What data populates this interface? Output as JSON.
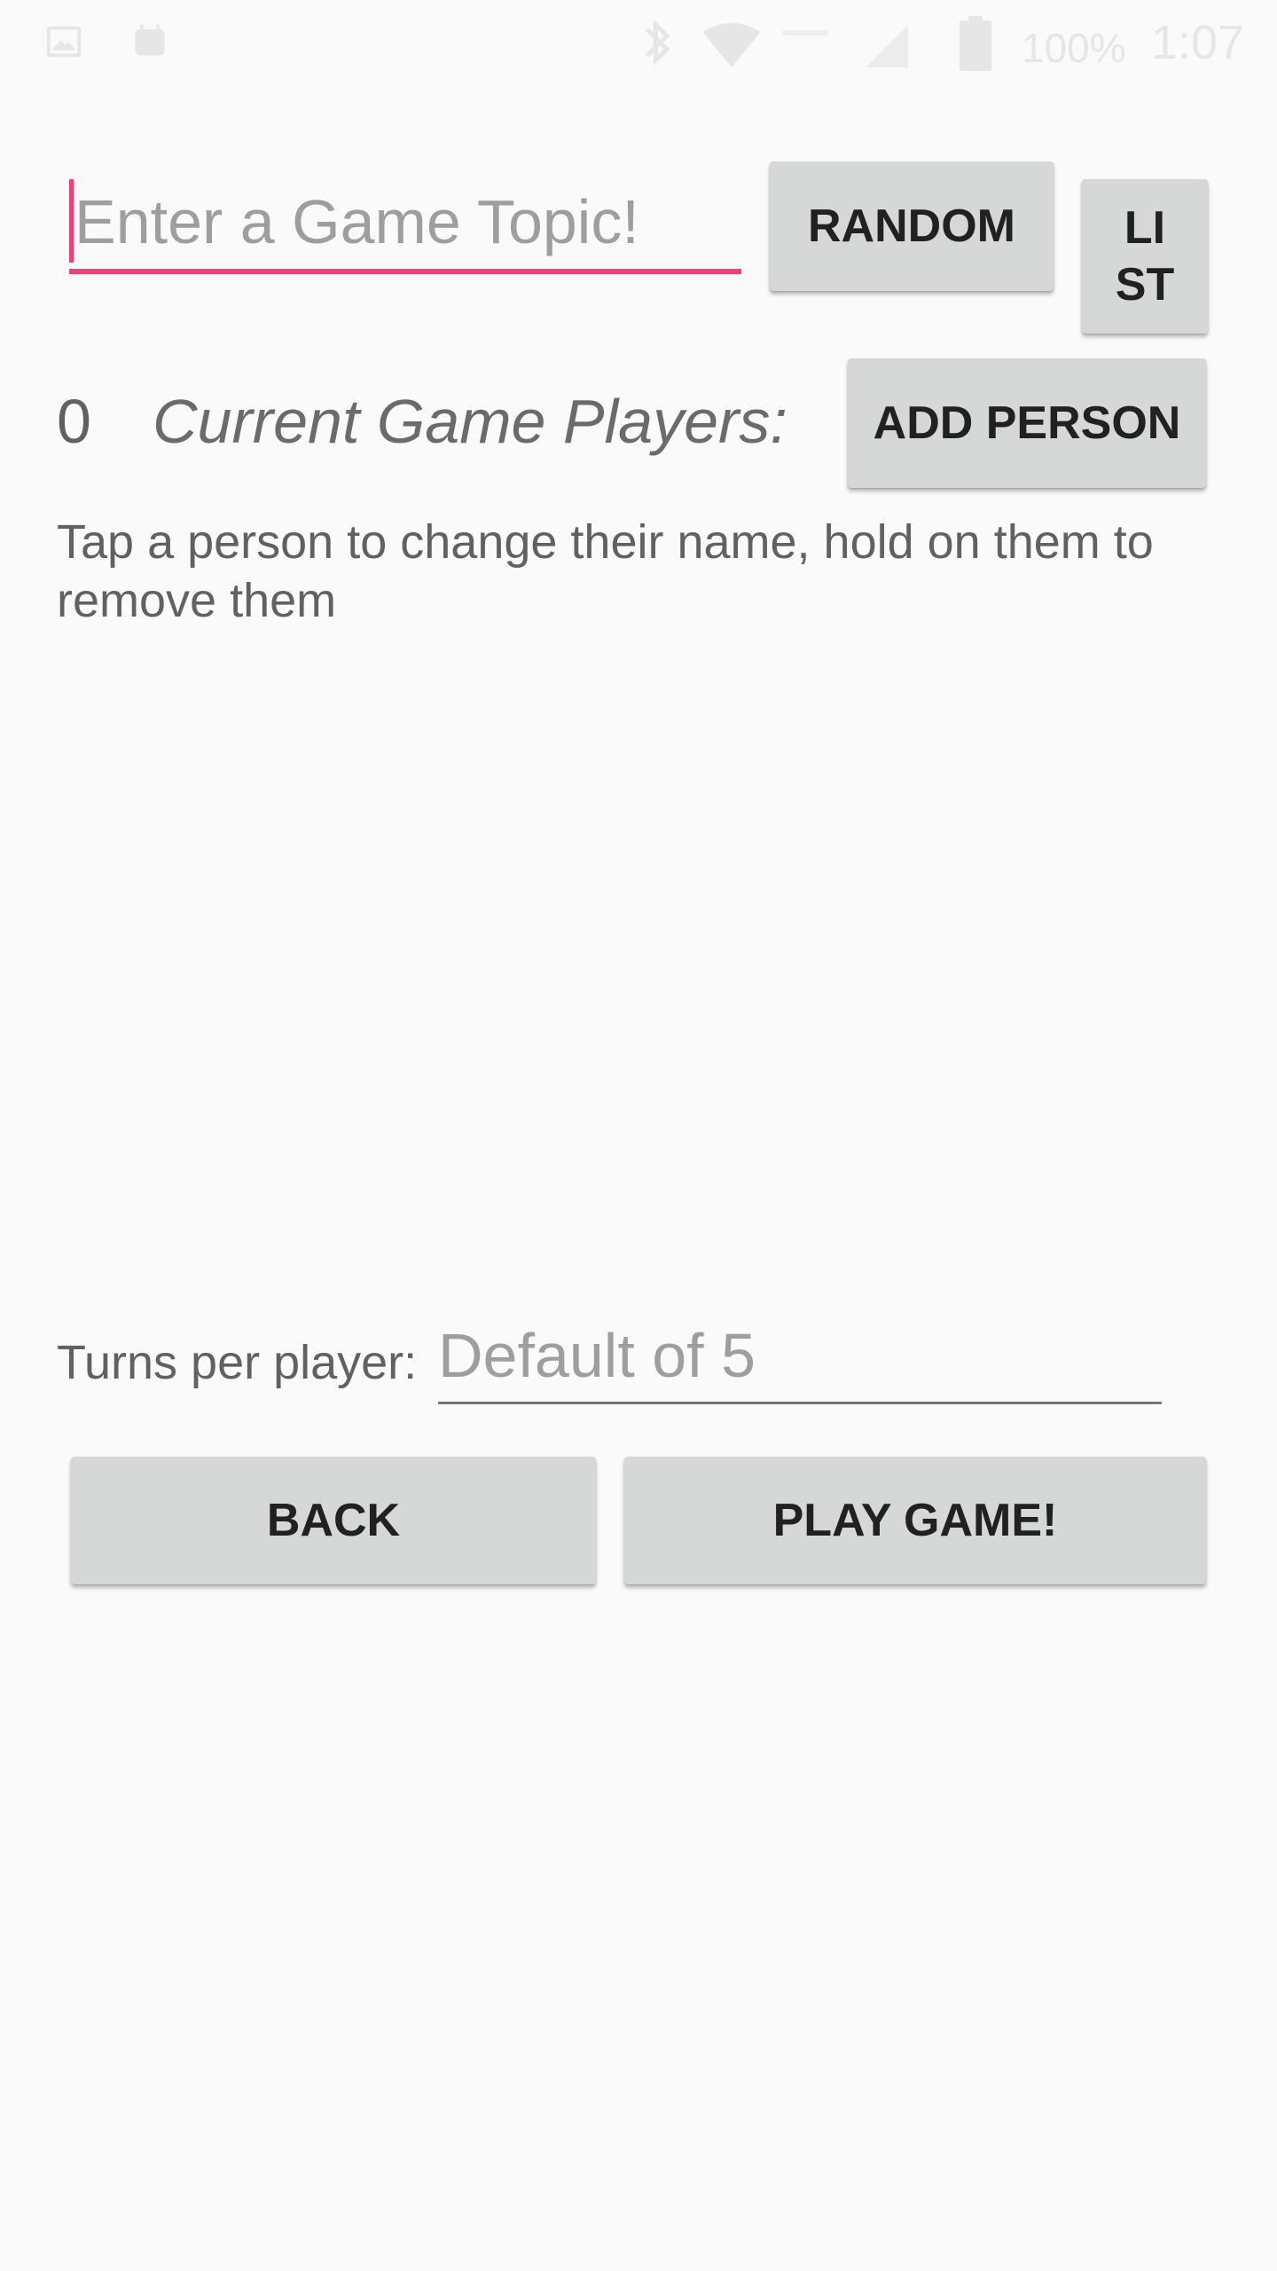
{
  "status_bar": {
    "icons": {
      "left": [
        "gallery-icon",
        "robot-icon"
      ],
      "right": [
        "bluetooth-icon",
        "wifi-icon",
        "data-icon",
        "signal-icon",
        "battery-icon"
      ]
    },
    "battery_percent": "100%",
    "time": "1:07",
    "text_color": "#e6e6e6"
  },
  "topic": {
    "placeholder": "Enter a Game Topic!",
    "value": ""
  },
  "buttons": {
    "random": "RANDOM",
    "list": "LI\nST",
    "add_person": "ADD PERSON",
    "back": "BACK",
    "play_game": "PLAY GAME!"
  },
  "players": {
    "count": "0",
    "heading": "Current Game Players:",
    "instructions": "Tap a person to change their name, hold on them to remove them",
    "items": []
  },
  "turns": {
    "label": "Turns per player:",
    "placeholder": "Default of 5",
    "value": ""
  },
  "colors": {
    "background": "#fafafa",
    "accent": "#ec407a",
    "button": "#d6d7d7",
    "button_text": "#212121",
    "secondary_text": "#616161",
    "hint_text": "#9e9e9e"
  }
}
